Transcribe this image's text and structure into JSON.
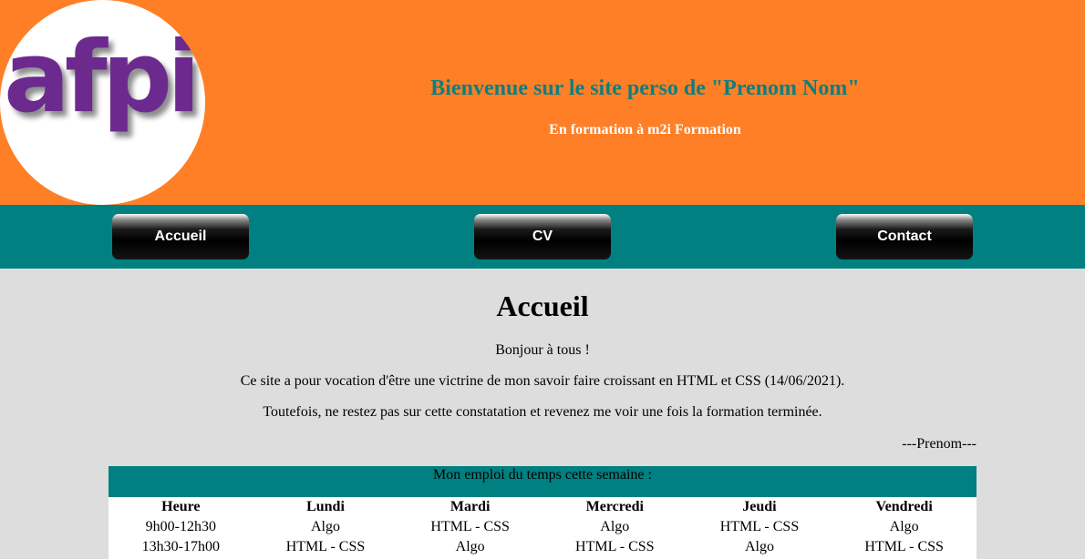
{
  "header": {
    "logo_text": "afpi",
    "welcome": "Bienvenue sur le site perso de \"Prenom Nom\"",
    "subtitle": "En formation à m2i Formation",
    "background": "#ff7f27"
  },
  "nav": {
    "items": [
      {
        "label": "Accueil"
      },
      {
        "label": "CV"
      },
      {
        "label": "Contact"
      }
    ],
    "background": "#008080"
  },
  "main": {
    "title": "Accueil",
    "greeting": "Bonjour à tous !",
    "intro": "Ce site a pour vocation d'être une victrine de mon savoir faire croissant en HTML et CSS (14/06/2021).",
    "outro": "Toutefois, ne restez pas sur cette constatation et revenez me voir une fois la formation terminée.",
    "signature": "---Prenom---"
  },
  "schedule": {
    "caption": "Mon emploi du temps cette semaine :",
    "headers": [
      "Heure",
      "Lundi",
      "Mardi",
      "Mercredi",
      "Jeudi",
      "Vendredi"
    ],
    "rows": [
      [
        "9h00-12h30",
        "Algo",
        "HTML - CSS",
        "Algo",
        "HTML - CSS",
        "Algo"
      ],
      [
        "13h30-17h00",
        "HTML - CSS",
        "Algo",
        "HTML - CSS",
        "Algo",
        "HTML - CSS"
      ]
    ]
  },
  "colors": {
    "accent_orange": "#ff7f27",
    "teal": "#008080",
    "title_teal": "#0f7e7e",
    "logo_purple": "#6c2a8e",
    "page_bg": "#dddddd"
  }
}
